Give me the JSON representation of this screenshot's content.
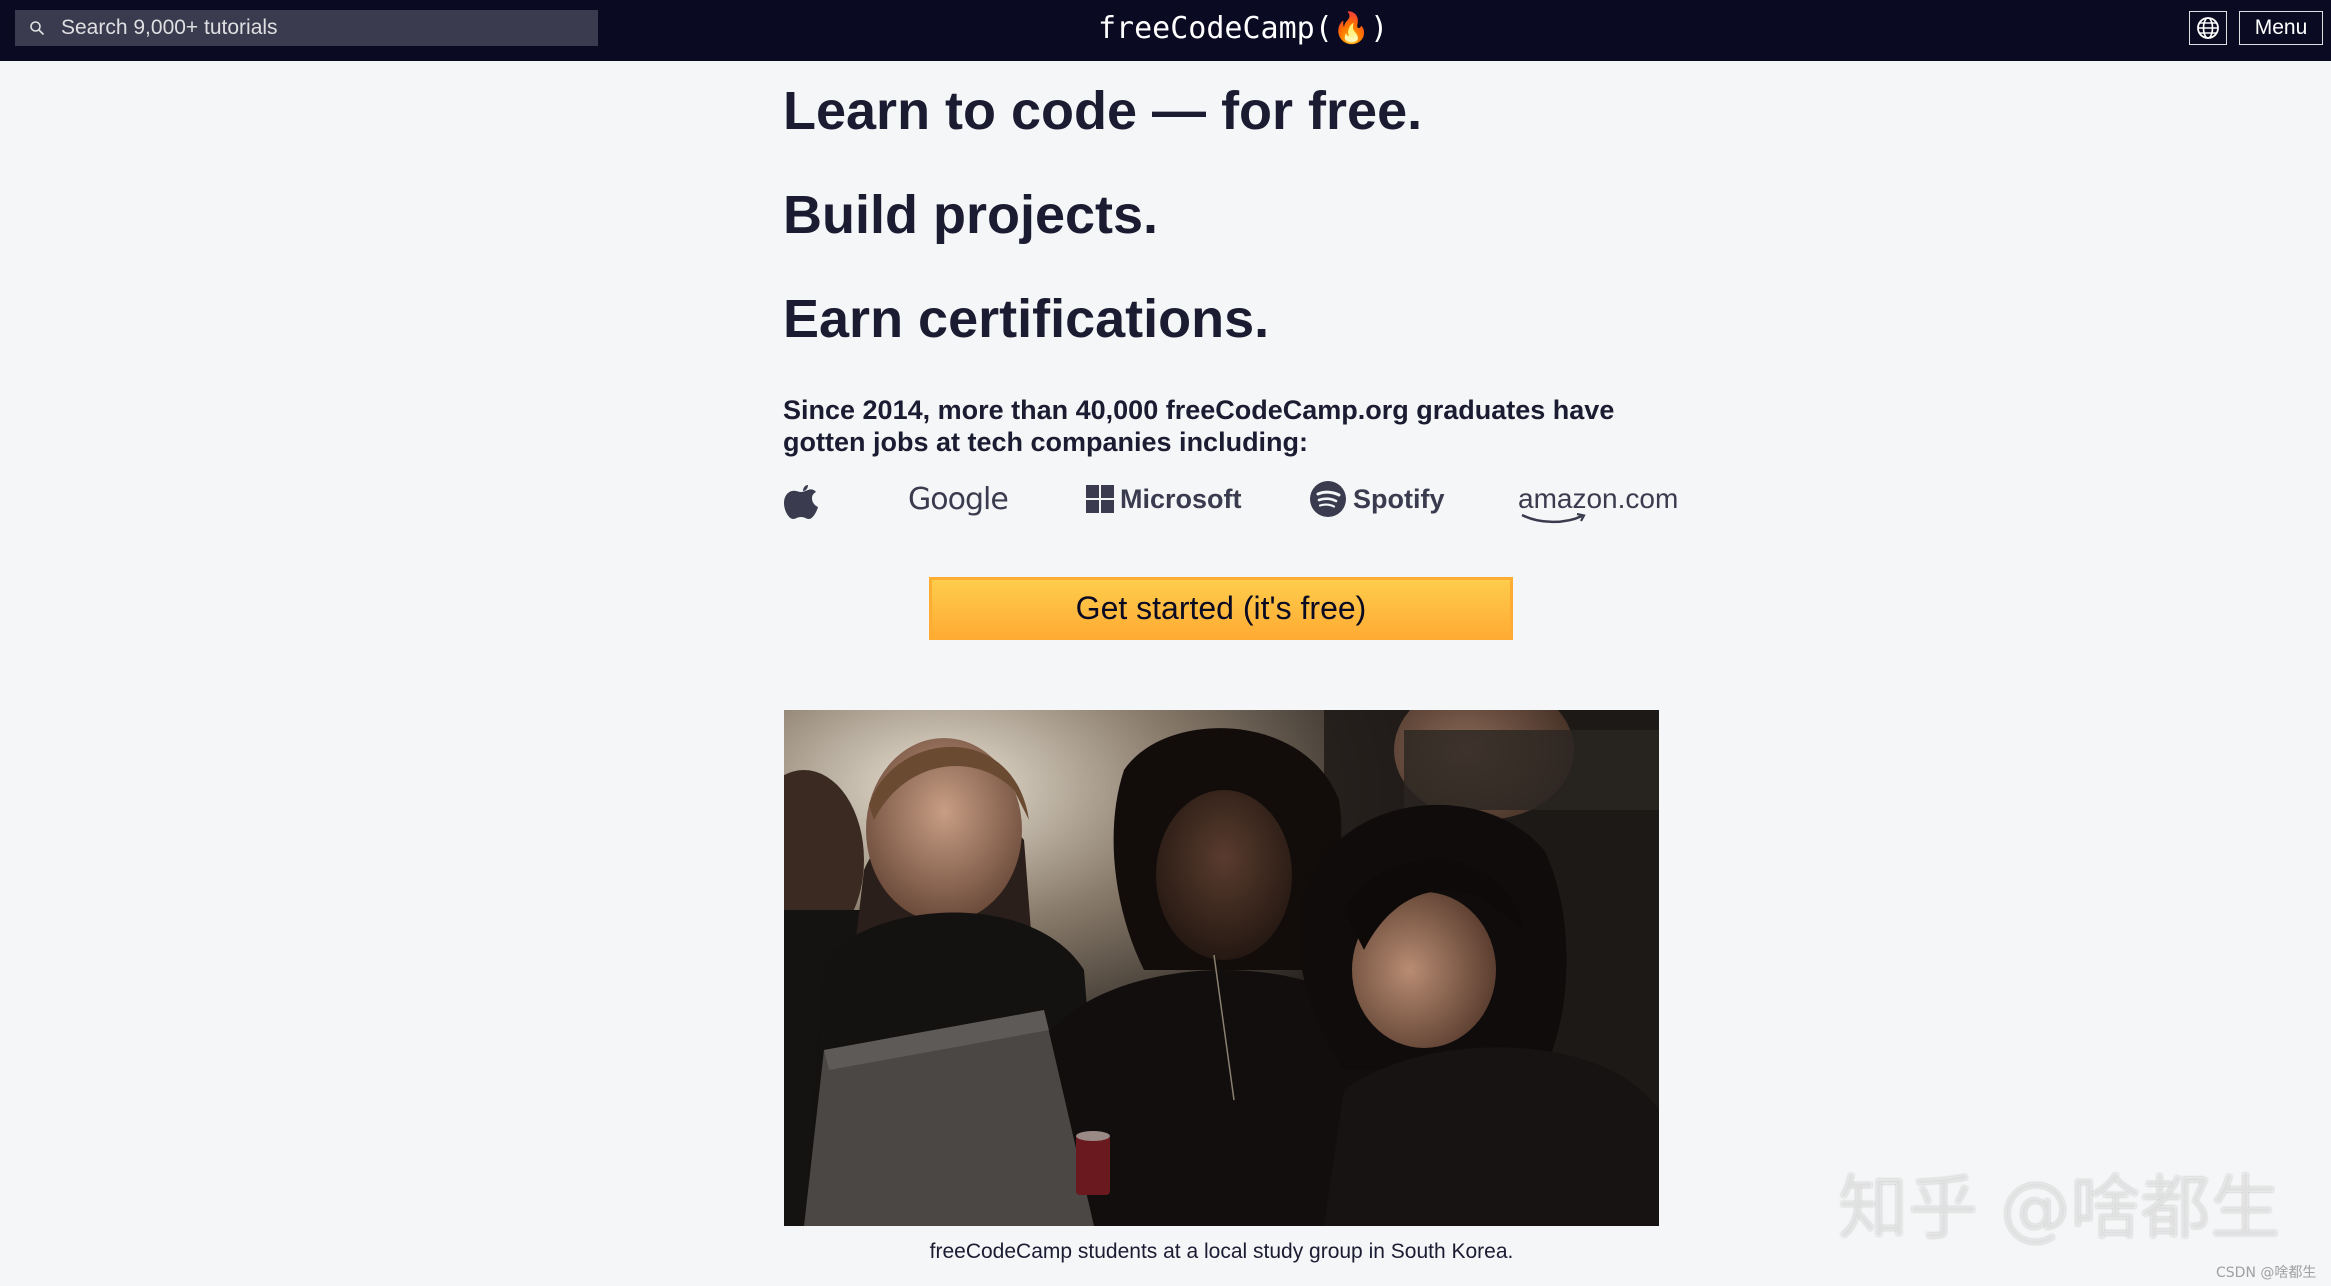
{
  "navbar": {
    "search_placeholder": "Search 9,000+ tutorials",
    "logo_text": "freeCodeCamp(🔥)",
    "menu_label": "Menu",
    "background": "#0a0a23"
  },
  "hero": {
    "line1": "Learn to code — for free.",
    "line2": "Build projects.",
    "line3": "Earn certifications.",
    "since_text": "Since 2014, more than 40,000 freeCodeCamp.org graduates have gotten jobs at tech companies including:"
  },
  "companies": [
    {
      "name": "apple-logo",
      "label": ""
    },
    {
      "name": "google-logo",
      "label": "Google"
    },
    {
      "name": "microsoft-logo",
      "label": "Microsoft"
    },
    {
      "name": "spotify-logo",
      "label": "Spotify"
    },
    {
      "name": "amazon-logo",
      "label": "amazon.com"
    }
  ],
  "cta": {
    "label": "Get started (it's free)",
    "color": "#ffac33"
  },
  "photo": {
    "caption": "freeCodeCamp students at a local study group in South Korea."
  },
  "watermark": {
    "text": "知乎 @啥都生",
    "small": "CSDN @啥都生"
  }
}
